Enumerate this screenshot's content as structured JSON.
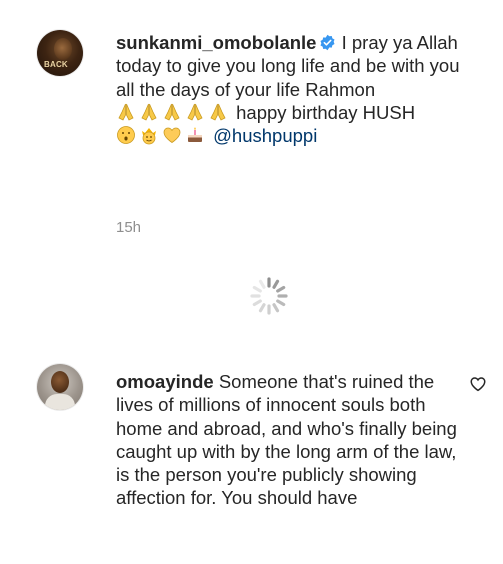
{
  "comments": [
    {
      "username": "sunkanmi_omobolanle",
      "verified": true,
      "text_before_emoji": "I pray ya Allah today to give you long life and be with you all the days of your life Rahmon",
      "emojis_1": [
        "folded-hands",
        "folded-hands",
        "folded-hands",
        "folded-hands",
        "folded-hands"
      ],
      "text_mid": "happy birthday HUSH",
      "emojis_2": [
        "hushed-face",
        "crown-face",
        "yellow-heart",
        "birthday-cake"
      ],
      "mention": "@hushpuppi",
      "timestamp": "15h"
    },
    {
      "username": "omoayinde",
      "verified": false,
      "text": "Someone that's ruined the lives of millions of innocent souls both home and abroad, and who's finally being caught up with by the long arm of the law, is the person you're publicly showing affection for. You should have"
    }
  ],
  "colors": {
    "text": "#262626",
    "secondary": "#8e8e8e",
    "verified": "#3897f0",
    "mention": "#00376b"
  }
}
